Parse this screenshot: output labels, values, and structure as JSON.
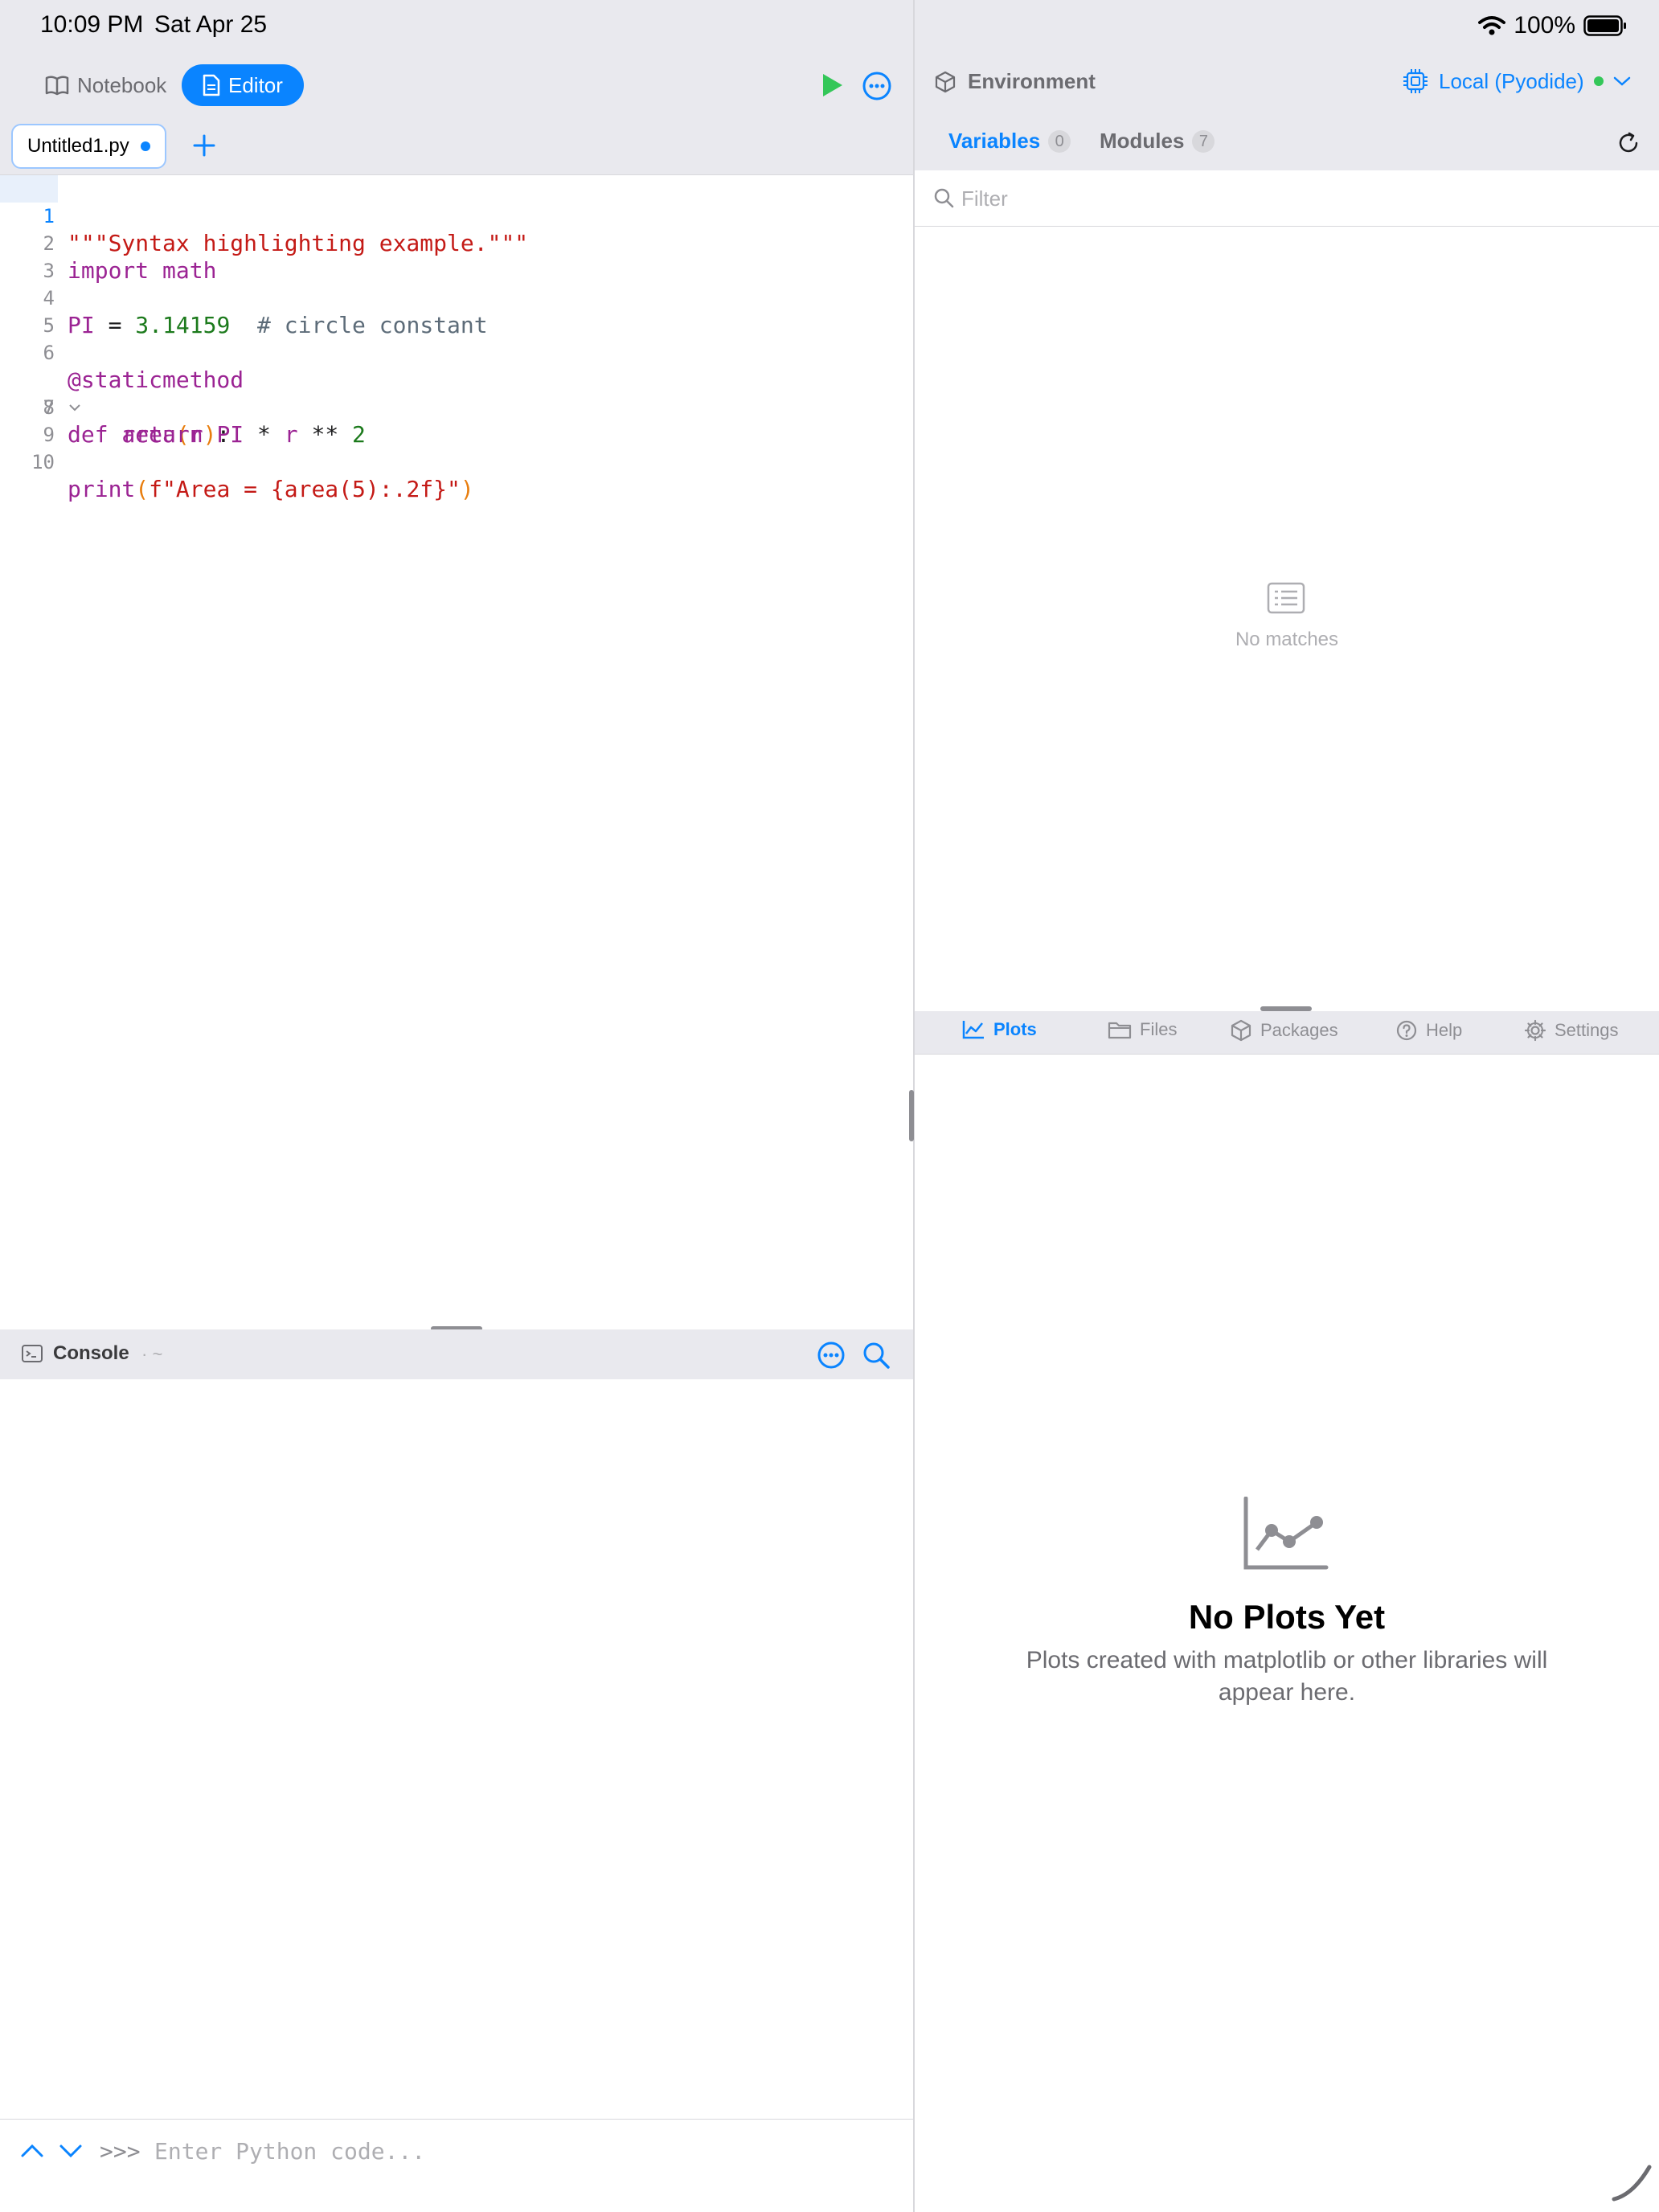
{
  "status": {
    "time": "10:09 PM",
    "date": "Sat Apr 25",
    "battery": "100%"
  },
  "left": {
    "mode_tabs": [
      {
        "label": "Notebook",
        "icon": "book-icon",
        "active": false
      },
      {
        "label": "Editor",
        "icon": "document-icon",
        "active": true
      }
    ],
    "file_tab": {
      "name": "Untitled1.py",
      "unsaved": true
    },
    "editor": {
      "lines": [
        {
          "n": "1"
        },
        {
          "n": "2"
        },
        {
          "n": "3"
        },
        {
          "n": "4"
        },
        {
          "n": "5"
        },
        {
          "n": "6"
        },
        {
          "n": "7"
        },
        {
          "n": "8"
        },
        {
          "n": "9"
        },
        {
          "n": "10"
        }
      ],
      "tokens": {
        "l1_str": "\"\"\"Syntax highlighting example.\"\"\"",
        "l2_kw": "import",
        "l2_mod": " math",
        "l4_name": "PI",
        "l4_eq": " = ",
        "l4_num": "3.14159",
        "l4_cmt": "  # circle constant",
        "l6_dec": "@staticmethod",
        "l7_kw": "def",
        "l7_name": " area",
        "l7_lp": "(",
        "l7_arg": "r",
        "l7_rp": ")",
        "l7_colon": ":",
        "l8_indent": "    ",
        "l8_kw": "return",
        "l8_name": " PI",
        "l8_op": " * ",
        "l8_r": "r",
        "l8_pow": " ** ",
        "l8_num": "2",
        "l10_fn": "print",
        "l10_lp": "(",
        "l10_str": "f\"Area = {area(5):.2f}\"",
        "l10_rp": ")"
      }
    },
    "console": {
      "title": "Console",
      "path": "· ~",
      "prompt": ">>>",
      "input_placeholder": "Enter Python code..."
    }
  },
  "right": {
    "environment_title": "Environment",
    "runtime": "Local (Pyodide)",
    "tabs": [
      {
        "label": "Variables",
        "count": "0",
        "active": true
      },
      {
        "label": "Modules",
        "count": "7",
        "active": false
      }
    ],
    "filter_placeholder": "Filter",
    "empty_vars": "No matches",
    "bottom_tabs": [
      {
        "label": "Plots",
        "icon": "chart-icon",
        "active": true
      },
      {
        "label": "Files",
        "icon": "folder-icon",
        "active": false
      },
      {
        "label": "Packages",
        "icon": "cube-icon",
        "active": false
      },
      {
        "label": "Help",
        "icon": "question-icon",
        "active": false
      },
      {
        "label": "Settings",
        "icon": "gear-icon",
        "active": false
      }
    ],
    "plots_empty": {
      "title": "No Plots Yet",
      "description": "Plots created with matplotlib or other libraries will appear here."
    }
  },
  "colors": {
    "accent": "#0a84ff",
    "run_green": "#34c759",
    "string": "#c41a16",
    "keyword": "#9b2393",
    "number": "#1c7a1c",
    "comment": "#5d6c79"
  }
}
